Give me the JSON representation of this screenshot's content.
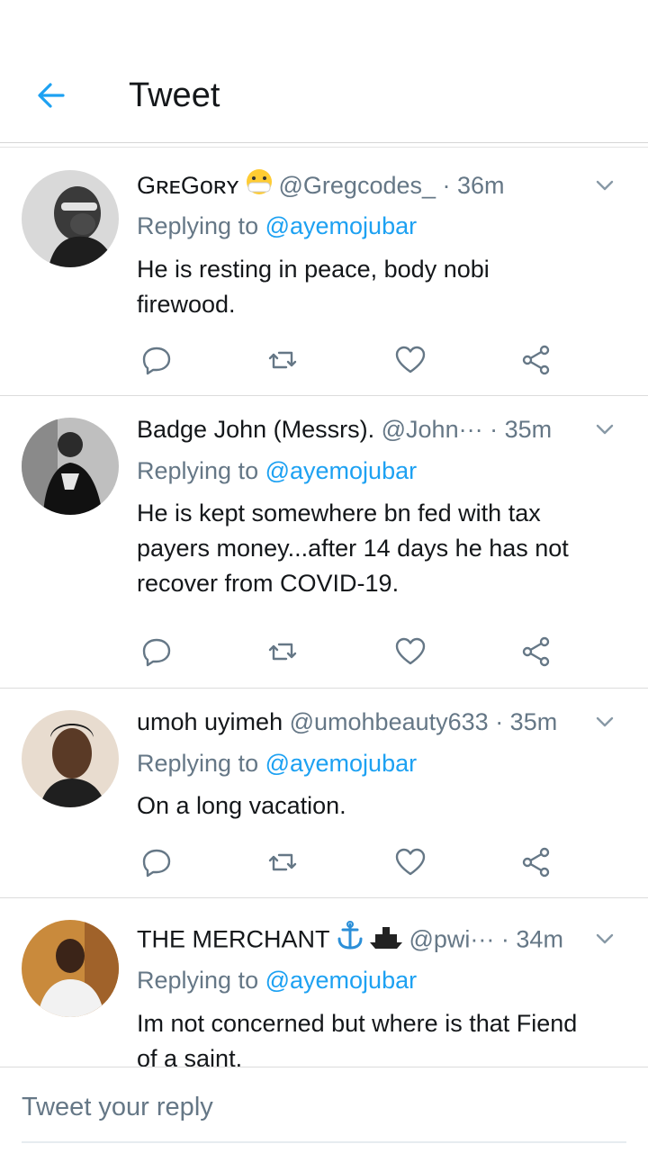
{
  "header": {
    "title": "Tweet",
    "back_icon": "arrow-left-icon",
    "accent": "#1da1f2"
  },
  "tweets": [
    {
      "display_name": "GʀᴇGᴏʀʏ",
      "emoji": "mask-face-emoji",
      "handle": "@Gregcodes_",
      "time": "· 36m",
      "replying_prefix": "Replying to",
      "replying_to": "@ayemojubar",
      "text_lines": [
        "He is resting in peace, body nobi",
        "firewood."
      ]
    },
    {
      "display_name": "Badge John (Messrs).",
      "handle": "@John···",
      "time": "· 35m",
      "replying_prefix": "Replying to",
      "replying_to": "@ayemojubar",
      "text_lines": [
        "He is kept somewhere bn fed with tax",
        "payers money...after 14 days he has not",
        "recover from COVID-19."
      ]
    },
    {
      "display_name": "umoh uyimeh",
      "handle": "@umohbeauty633",
      "time": "· 35m",
      "replying_prefix": "Replying to",
      "replying_to": "@ayemojubar",
      "text_lines": [
        "On a long vacation."
      ]
    },
    {
      "display_name": "THE MERCHANT",
      "emoji": "anchor-ship-emoji",
      "handle": "@pwi···",
      "time": "· 34m",
      "replying_prefix": "Replying to",
      "replying_to": "@ayemojubar",
      "text_lines": [
        "Im not concerned but where is that Fiend",
        "of a saint."
      ]
    }
  ],
  "composer": {
    "placeholder": "Tweet your reply"
  },
  "colors": {
    "text": "#14171a",
    "muted": "#657786",
    "link": "#1da1f2",
    "divider": "#dcdcdc"
  }
}
